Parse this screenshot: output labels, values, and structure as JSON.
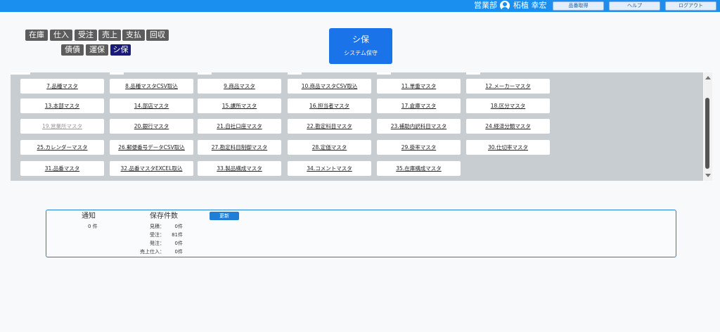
{
  "header": {
    "department": "営業部",
    "user_name": "柘植 幸宏",
    "buttons": [
      "品番取得",
      "ヘルプ",
      "ログアウト"
    ]
  },
  "modules": {
    "row1": [
      "在庫",
      "仕入",
      "受注",
      "売上",
      "支払",
      "回収"
    ],
    "row2": [
      "債債",
      "運保",
      "シ保"
    ],
    "active": "シ保"
  },
  "system_box": {
    "title": "シ保",
    "subtitle": "システム保守"
  },
  "masters": [
    [
      "7.品種マスタ",
      "8.品種マスタCSV取込",
      "9.商品マスタ",
      "10.商品マスタCSV取込",
      "11.単重マスタ",
      "12.メーカーマスタ"
    ],
    [
      "13.本部マスタ",
      "14.部店マスタ",
      "15.課所マスタ",
      "16.担当者マスタ",
      "17.倉庫マスタ",
      "18.区分マスタ"
    ],
    [
      "19.営業所マスタ",
      "20.銀行マスタ",
      "21.自社口座マスタ",
      "22.勘定科目マスタ",
      "23.補助内訳科目マスタ",
      "24.経済分類マスタ"
    ],
    [
      "25.カレンダーマスタ",
      "26.郵便番号データCSV取込",
      "27.勘定科目制御マスタ",
      "28.定価マスタ",
      "29.掛率マスタ",
      "30.仕切率マスタ"
    ],
    [
      "31.品番マスタ",
      "32.品番マスタEXCEL取込",
      "33.製品構成マスタ",
      "34.コメントマスタ",
      "35.在庫構成マスタ"
    ]
  ],
  "disabled_masters": [
    "19.営業所マスタ"
  ],
  "notice": {
    "title": "通知",
    "count": "0 件",
    "saved_title": "保存件数",
    "update_label": "更新",
    "rows": [
      {
        "label": "見積：",
        "value": "0件"
      },
      {
        "label": "受注：",
        "value": "81件"
      },
      {
        "label": "発注：",
        "value": "0件"
      },
      {
        "label": "売上仕入：",
        "value": "0件"
      }
    ]
  },
  "colors": {
    "header": "#1a8ff0",
    "module": "#5c5c5c",
    "module_active": "#1a1a78",
    "accent": "#1a73e8",
    "panel": "#c8cdd2"
  }
}
